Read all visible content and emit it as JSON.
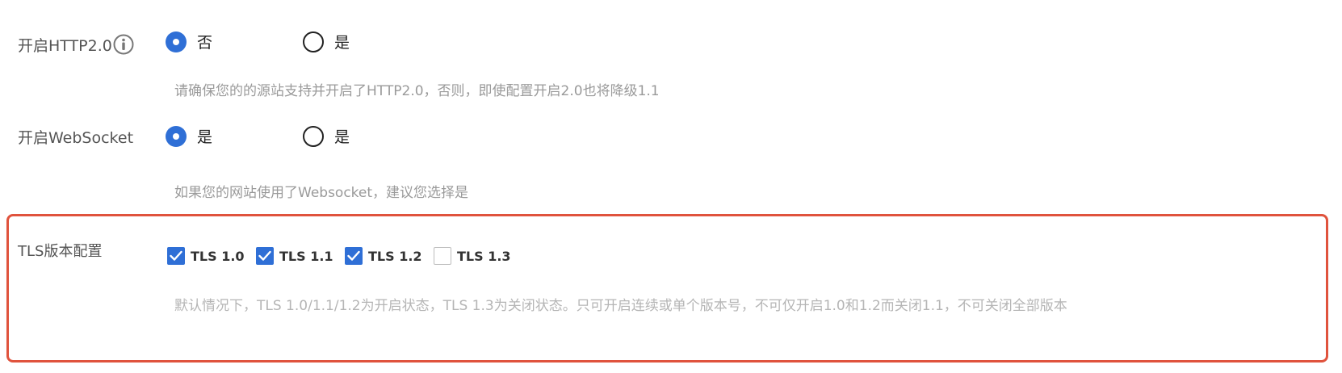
{
  "http2": {
    "label": "开启HTTP2.0",
    "info_icon": "info-icon",
    "options": [
      {
        "label": "否",
        "selected": true
      },
      {
        "label": "是",
        "selected": false
      }
    ],
    "hint": "请确保您的的源站支持并开启了HTTP2.0，否则，即使配置开启2.0也将降级1.1"
  },
  "websocket": {
    "label": "开启WebSocket",
    "options": [
      {
        "label": "是",
        "selected": true
      },
      {
        "label": "是",
        "selected": false
      }
    ],
    "hint": "如果您的网站使用了Websocket，建议您选择是"
  },
  "tls": {
    "label": "TLS版本配置",
    "options": [
      {
        "label": "TLS 1.0",
        "checked": true
      },
      {
        "label": "TLS 1.1",
        "checked": true
      },
      {
        "label": "TLS 1.2",
        "checked": true
      },
      {
        "label": "TLS 1.3",
        "checked": false
      }
    ],
    "hint": "默认情况下，TLS 1.0/1.1/1.2为开启状态，TLS 1.3为关闭状态。只可开启连续或单个版本号，不可仅开启1.0和1.2而关闭1.1，不可关闭全部版本",
    "highlight_color": "#e0533d"
  },
  "colors": {
    "accent": "#2f6fd6",
    "hint_text": "#9a9a9a"
  }
}
